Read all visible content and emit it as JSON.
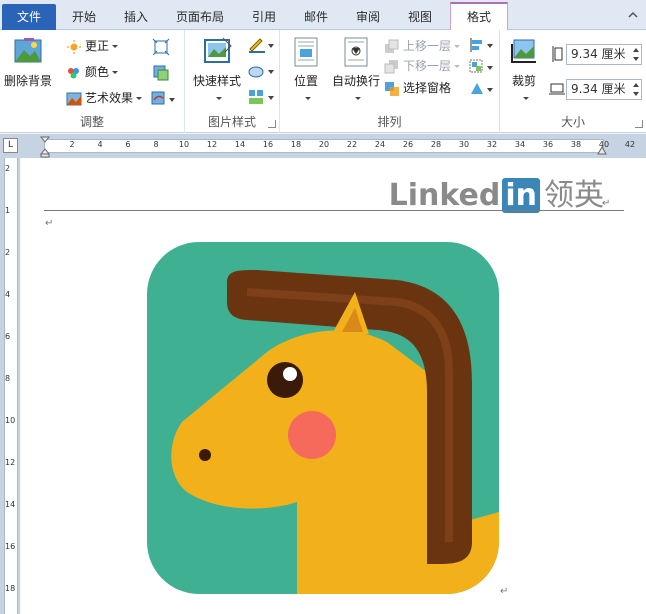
{
  "tabs": [
    {
      "label": "文件"
    },
    {
      "label": "开始"
    },
    {
      "label": "插入"
    },
    {
      "label": "页面布局"
    },
    {
      "label": "引用"
    },
    {
      "label": "邮件"
    },
    {
      "label": "审阅"
    },
    {
      "label": "视图"
    },
    {
      "label": "格式"
    }
  ],
  "ribbon": {
    "adjust": {
      "group_label": "调整",
      "remove_bg": "删除背景",
      "correct": "更正",
      "color": "颜色",
      "artistic": "艺术效果"
    },
    "picture_styles": {
      "group_label": "图片样式",
      "quick_styles": "快速样式"
    },
    "arrange": {
      "group_label": "排列",
      "position": "位置",
      "wrap_text": "自动换行",
      "bring_forward": "上移一层",
      "send_backward": "下移一层",
      "selection_pane": "选择窗格"
    },
    "size": {
      "group_label": "大小",
      "crop": "裁剪",
      "height": "9.34 厘米",
      "width": "9.34 厘米"
    }
  },
  "ruler": {
    "corner": "L",
    "numbers": [
      "2",
      "2",
      "4",
      "6",
      "8",
      "10",
      "12",
      "14",
      "16",
      "18",
      "20",
      "22",
      "24",
      "26",
      "28",
      "30",
      "32",
      "34",
      "36",
      "38",
      "40",
      "42"
    ],
    "vnumbers": [
      "2",
      "1",
      "2",
      "4",
      "6",
      "8",
      "10",
      "12",
      "14",
      "16",
      "18"
    ]
  },
  "document": {
    "watermark_brand": "Linked",
    "watermark_in": "in",
    "watermark_cn": "领英",
    "pilcrow": "↵"
  },
  "colors": {
    "file_tab": "#2a64b8",
    "format_tab_accent": "#b36db3",
    "icon_bg": "#3fb091",
    "horse_body": "#f2b01a",
    "horse_mane": "#6b3410",
    "cheek": "#f56a5a"
  }
}
